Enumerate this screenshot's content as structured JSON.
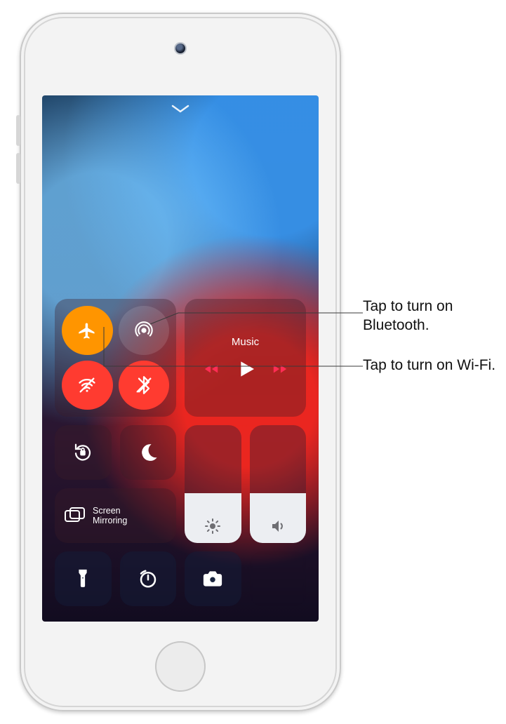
{
  "music": {
    "title": "Music"
  },
  "screen_mirroring": {
    "label": "Screen\nMirroring"
  },
  "connectivity": {
    "airplane_mode": {
      "on": true
    },
    "airdrop": {
      "on": false
    },
    "wifi": {
      "on": false
    },
    "bluetooth": {
      "on": false
    }
  },
  "sliders": {
    "brightness_pct": 42,
    "volume_pct": 42
  },
  "callouts": {
    "bluetooth": "Tap to turn on Bluetooth.",
    "wifi": "Tap to turn on Wi-Fi."
  }
}
